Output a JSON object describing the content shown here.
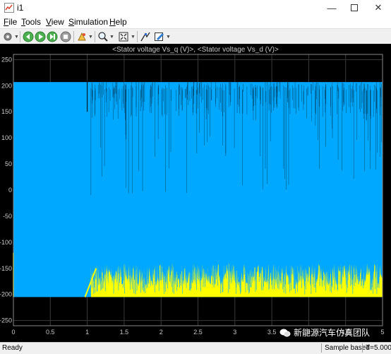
{
  "window": {
    "title": "i1"
  },
  "menu": {
    "items": [
      "File",
      "Tools",
      "View",
      "Simulation",
      "Help"
    ],
    "underline": [
      "F",
      "T",
      "V",
      "S",
      "H"
    ]
  },
  "toolbar": {
    "buttons": [
      "settings-gear-icon",
      "run-icon",
      "step-forward-icon",
      "stop-icon",
      "highlight-icon",
      "zoom-icon",
      "autoscale-icon",
      "cursor-measure-icon",
      "style-icon"
    ]
  },
  "plot": {
    "title": "<Stator voltage Vs_q (V)>, <Stator voltage Vs_d (V)>",
    "background": "#000000",
    "title_color": "#c8c8c8",
    "tick_color": "#c8c8c8",
    "grid_color": "#3a3a3a"
  },
  "chart_data": {
    "type": "line",
    "title": "<Stator voltage Vs_q (V)>, <Stator voltage Vs_d (V)>",
    "xlabel": "",
    "ylabel": "",
    "xlim": [
      0,
      5
    ],
    "ylim": [
      -260,
      260
    ],
    "x_ticks": [
      0,
      0.5,
      1,
      1.5,
      2,
      2.5,
      3,
      3.5,
      4,
      4.5,
      5
    ],
    "x_tick_labels": [
      "0",
      "0.5",
      "1",
      "1.5",
      "2",
      "2.5",
      "3",
      "3.5",
      "4",
      "4.5",
      "5"
    ],
    "y_ticks": [
      250,
      200,
      150,
      100,
      50,
      0,
      -50,
      -100,
      -150,
      -200,
      -250
    ],
    "grid": true,
    "series": [
      {
        "color": "#00a8ff",
        "description_range": [
          -205,
          207
        ],
        "x_start": 0,
        "x_end": 5
      },
      {
        "color": "#ffff00",
        "switch_time": 1.05,
        "band_low": -205,
        "band_high_after": -130,
        "x_start": 0,
        "x_end": 5
      }
    ]
  },
  "status": {
    "ready": "Ready",
    "mode": "Sample based",
    "time": "T=5.000"
  },
  "watermark": {
    "text": "新能源汽车仿真团队"
  }
}
